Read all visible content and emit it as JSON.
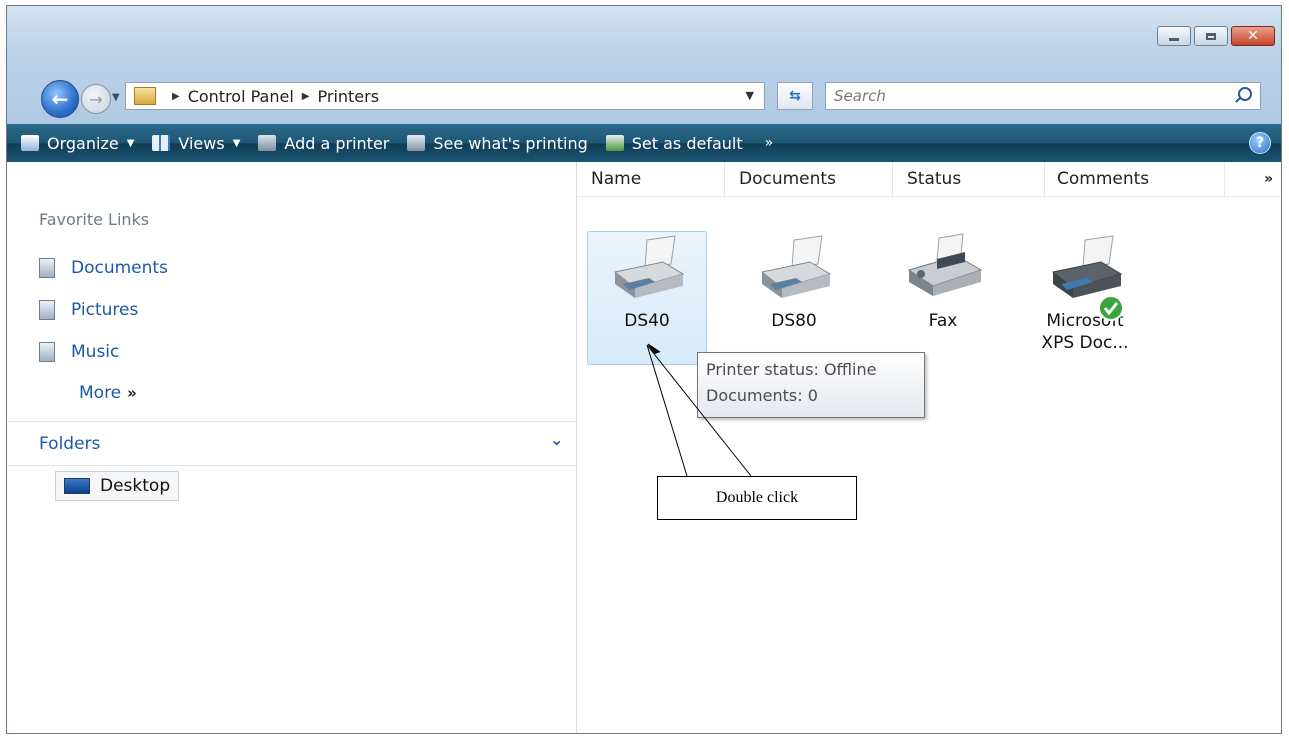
{
  "window": {
    "buttons": [
      "minimize",
      "maximize",
      "close"
    ]
  },
  "address_bar": {
    "crumbs": [
      "Control Panel",
      "Printers"
    ]
  },
  "search": {
    "placeholder": "Search"
  },
  "toolbar": {
    "organize": "Organize",
    "views": "Views",
    "add_printer": "Add a printer",
    "see_printing": "See what's printing",
    "set_default": "Set as default",
    "more": "»",
    "help": "?"
  },
  "nav_pane": {
    "favorite_links": "Favorite Links",
    "links": [
      "Documents",
      "Pictures",
      "Music"
    ],
    "more": "More",
    "more_glyph": "»",
    "folders": "Folders",
    "desktop": "Desktop"
  },
  "columns": [
    "Name",
    "Documents",
    "Status",
    "Comments"
  ],
  "columns_more": "»",
  "printers": [
    {
      "name": "DS40",
      "selected": true
    },
    {
      "name": "DS80",
      "selected": false
    },
    {
      "name": "Fax",
      "selected": false
    },
    {
      "name": "Microsoft XPS Doc...",
      "line1": "Microsoft",
      "line2": "XPS Doc...",
      "default": true
    }
  ],
  "tooltip": {
    "line1": "Printer status: Offline",
    "line2": "Documents: 0"
  },
  "annotation": {
    "text": "Double click"
  }
}
